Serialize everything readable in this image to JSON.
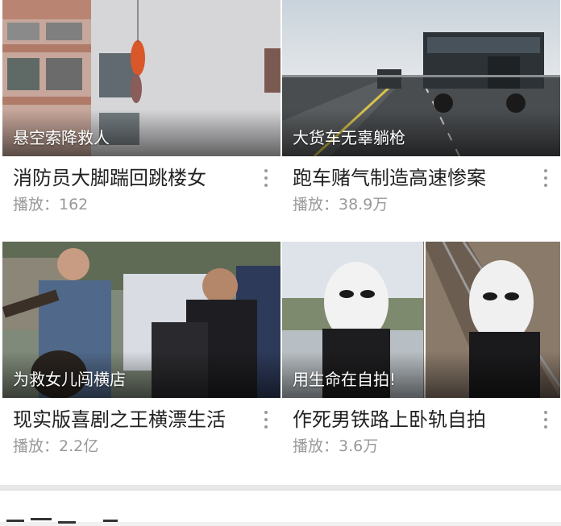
{
  "feed": {
    "items": [
      {
        "overlay": "悬空索降救人",
        "title": "消防员大脚踹回跳楼女",
        "plays": "播放：162",
        "thumb": "building-rescue"
      },
      {
        "overlay": "大货车无辜躺枪",
        "title": "跑车赌气制造高速惨案",
        "plays": "播放：38.9万",
        "thumb": "highway-truck"
      },
      {
        "overlay": "为救女儿闯横店",
        "title": "现实版喜剧之王横漂生活",
        "plays": "播放：2.2亿",
        "thumb": "costume-actors"
      },
      {
        "overlay": "用生命在自拍!",
        "title": "作死男铁路上卧轨自拍",
        "plays": "播放：3.6万",
        "thumb": "masked-railway"
      }
    ]
  },
  "icons": {
    "more": "more-vertical-icon"
  },
  "colors": {
    "title": "#222222",
    "meta": "#999999",
    "background": "#f0f0f0"
  }
}
